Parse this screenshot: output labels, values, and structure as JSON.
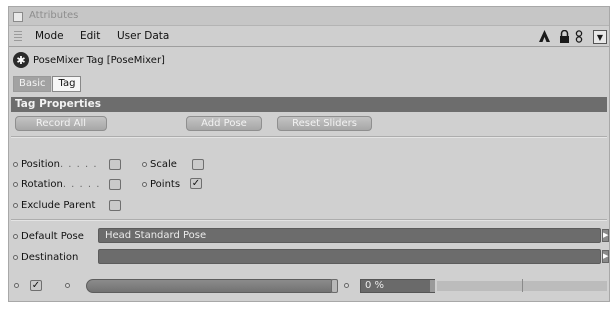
{
  "window": {
    "title": "Attributes"
  },
  "menu": {
    "items": [
      "Mode",
      "Edit",
      "User Data"
    ]
  },
  "toolbar_icons": [
    "arrow-cursor-icon",
    "lock-icon",
    "link-icon",
    "panel-menu-icon"
  ],
  "object": {
    "name": "PoseMixer Tag [PoseMixer]",
    "icon": "pose-mixer-icon"
  },
  "tabs": [
    {
      "label": "Basic",
      "active": false
    },
    {
      "label": "Tag",
      "active": true
    }
  ],
  "section": {
    "title": "Tag Properties"
  },
  "buttons": {
    "record_all": "Record All",
    "add_pose": "Add Pose",
    "reset_sliders": "Reset Sliders"
  },
  "params": {
    "position": {
      "label": "Position",
      "dots": ". . . . .",
      "checked": false
    },
    "scale": {
      "label": "Scale",
      "checked": false
    },
    "rotation": {
      "label": "Rotation",
      "dots": ". . . . .",
      "checked": false
    },
    "points": {
      "label": "Points",
      "checked": true
    },
    "exclude_parent": {
      "label": "Exclude Parent",
      "checked": false
    },
    "default_pose": {
      "label": "Default Pose",
      "value": "Head Standard Pose"
    },
    "destination": {
      "label": "Destination",
      "value": ""
    }
  },
  "pose_row": {
    "enabled": true,
    "percent_value": "0 %",
    "slider_level": 1.0
  },
  "colors": {
    "panel": "#d0d0d0",
    "section_bar": "#6d6d6d",
    "link_field": "#6c6c6c"
  }
}
